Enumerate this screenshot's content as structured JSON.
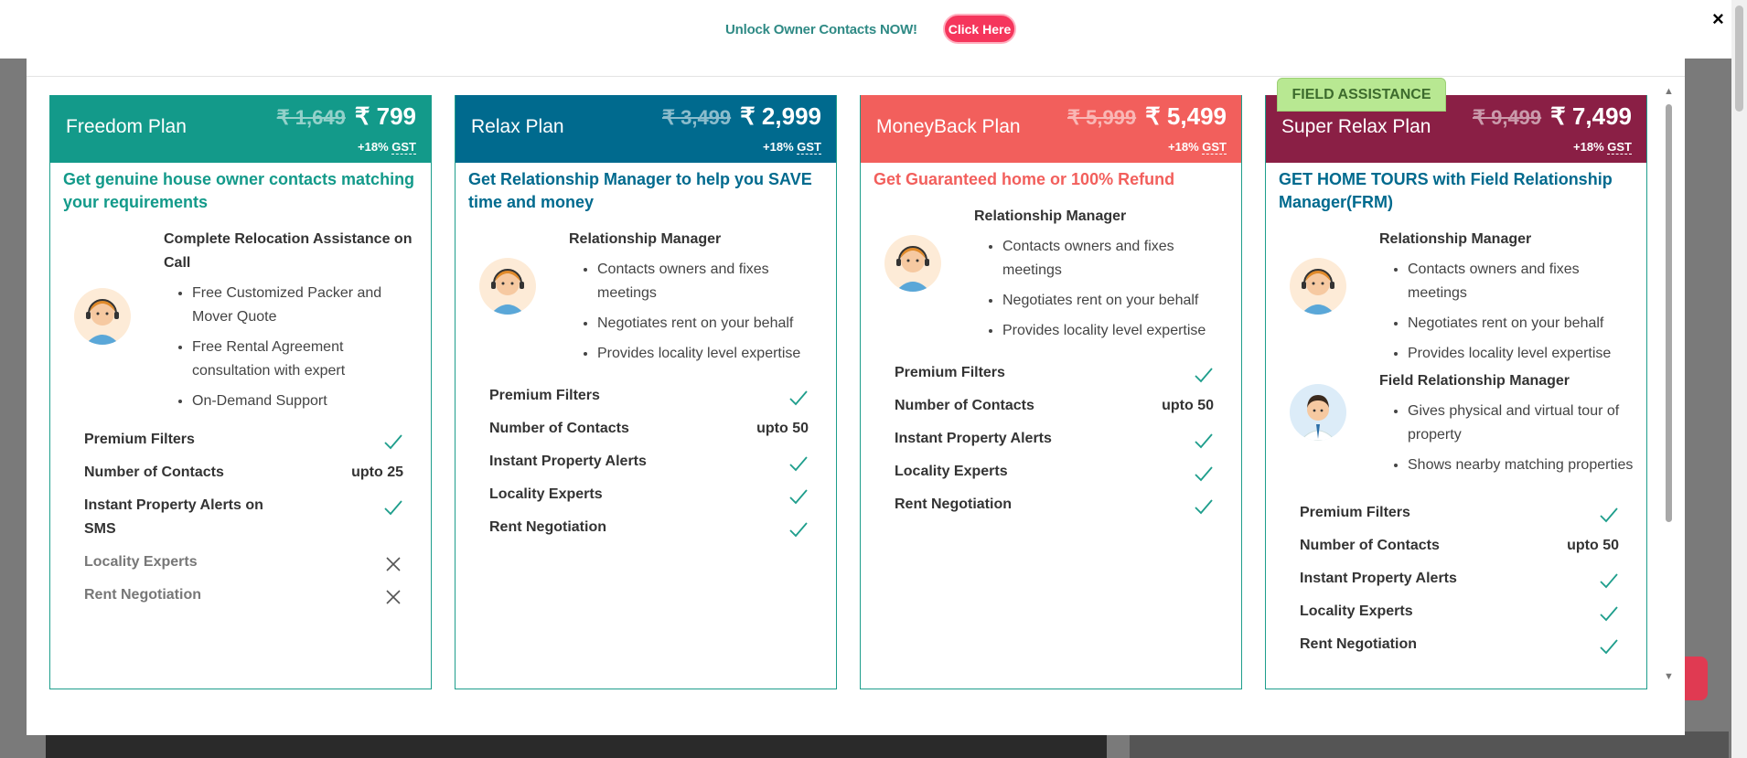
{
  "banner": {
    "text": "Unlock Owner Contacts NOW!",
    "button_label": "Click Here",
    "close_label": "×"
  },
  "colors": {
    "freedom": "#139a8a",
    "relax": "#006a8e",
    "moneyback": "#f25f5c",
    "superrelax": "#8a1f45",
    "accent_green": "#1e9e8c",
    "badge": "#b8e892"
  },
  "field_badge": "FIELD ASSISTANCE",
  "plans": [
    {
      "name": "Freedom Plan",
      "old_price": "₹ 1,649",
      "price": "₹ 799",
      "gst_prefix": "+18%",
      "gst": "GST",
      "tagline": "Get genuine house owner contacts matching your requirements",
      "rm_title": "Complete Relocation Assistance on Call",
      "rm_points": [
        "Free Customized Packer and Mover Quote",
        "Free Rental Agreement consultation with expert",
        "On-Demand Support"
      ],
      "features": [
        {
          "label": "Premium Filters",
          "value": "check"
        },
        {
          "label": "Number of Contacts",
          "value": "upto 25"
        },
        {
          "label": "Instant Property Alerts on SMS",
          "value": "check"
        },
        {
          "label": "Locality Experts",
          "value": "cross"
        },
        {
          "label": "Rent Negotiation",
          "value": "cross"
        }
      ]
    },
    {
      "name": "Relax Plan",
      "old_price": "₹ 3,499",
      "price": "₹ 2,999",
      "gst_prefix": "+18%",
      "gst": "GST",
      "tagline": "Get Relationship Manager to help you SAVE time and money",
      "rm_title": "Relationship Manager",
      "rm_points": [
        "Contacts owners and fixes meetings",
        "Negotiates rent on your behalf",
        "Provides locality level expertise"
      ],
      "features": [
        {
          "label": "Premium Filters",
          "value": "check"
        },
        {
          "label": "Number of Contacts",
          "value": "upto 50"
        },
        {
          "label": "Instant Property Alerts",
          "value": "check"
        },
        {
          "label": "Locality Experts",
          "value": "check"
        },
        {
          "label": "Rent Negotiation",
          "value": "check"
        }
      ]
    },
    {
      "name": "MoneyBack Plan",
      "old_price": "₹ 5,999",
      "price": "₹ 5,499",
      "gst_prefix": "+18%",
      "gst": "GST",
      "tagline": "Get Guaranteed home or 100% Refund",
      "rm_title": "Relationship Manager",
      "rm_points": [
        "Contacts owners and fixes meetings",
        "Negotiates rent on your behalf",
        "Provides locality level expertise"
      ],
      "features": [
        {
          "label": "Premium Filters",
          "value": "check"
        },
        {
          "label": "Number of Contacts",
          "value": "upto 50"
        },
        {
          "label": "Instant Property Alerts",
          "value": "check"
        },
        {
          "label": "Locality Experts",
          "value": "check"
        },
        {
          "label": "Rent Negotiation",
          "value": "check"
        }
      ]
    },
    {
      "name": "Super Relax Plan",
      "old_price": "₹ 9,499",
      "price": "₹ 7,499",
      "gst_prefix": "+18%",
      "gst": "GST",
      "tagline": "GET HOME TOURS with Field Relationship Manager(FRM)",
      "rm_title": "Relationship Manager",
      "rm_points": [
        "Contacts owners and fixes meetings",
        "Negotiates rent on your behalf",
        "Provides locality level expertise"
      ],
      "frm_title": "Field Relationship Manager",
      "frm_points": [
        "Gives physical and virtual tour of property",
        "Shows nearby matching properties"
      ],
      "features": [
        {
          "label": "Premium Filters",
          "value": "check"
        },
        {
          "label": "Number of Contacts",
          "value": "upto 50"
        },
        {
          "label": "Instant Property Alerts",
          "value": "check"
        },
        {
          "label": "Locality Experts",
          "value": "check"
        },
        {
          "label": "Rent Negotiation",
          "value": "check"
        }
      ]
    }
  ]
}
